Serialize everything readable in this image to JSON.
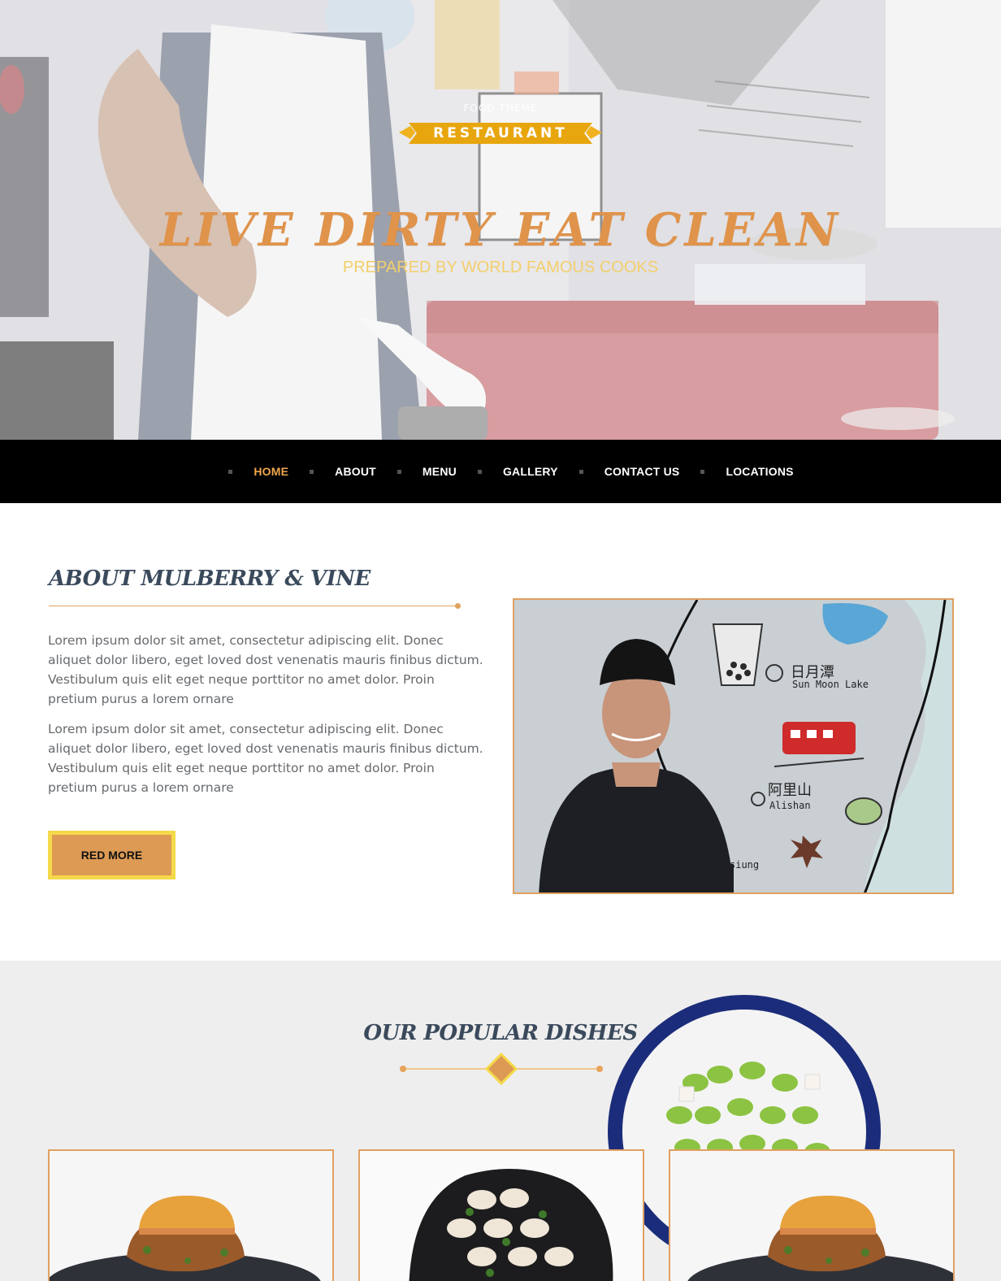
{
  "hero": {
    "kicker": "FOOD THEME",
    "ribbon_label": "RESTAURANT",
    "title": "LIVE DIRTY EAT CLEAN",
    "subtitle": "PREPARED BY WORLD FAMOUS COOKS"
  },
  "nav": {
    "items": [
      {
        "label": "HOME",
        "active": true
      },
      {
        "label": "ABOUT",
        "active": false
      },
      {
        "label": "MENU",
        "active": false
      },
      {
        "label": "GALLERY",
        "active": false
      },
      {
        "label": "CONTACT US",
        "active": false
      },
      {
        "label": "LOCATIONS",
        "active": false
      }
    ]
  },
  "about": {
    "title": "ABOUT MULBERRY & VINE",
    "paragraphs": [
      "Lorem ipsum dolor sit amet, consectetur adipiscing elit. Donec aliquet dolor libero, eget loved dost venenatis mauris finibus dictum. Vestibulum quis elit eget neque porttitor no amet dolor. Proin pretium purus a lorem ornare",
      "Lorem ipsum dolor sit amet, consectetur adipiscing elit. Donec aliquet dolor libero, eget loved dost venenatis mauris finibus dictum. Vestibulum quis elit eget neque porttitor no amet dolor. Proin pretium purus a lorem ornare"
    ],
    "button_label": "RED MORE",
    "photo_map_labels": {
      "lake_cn": "日月潭",
      "lake_en": "Sun Moon Lake",
      "mountain_cn": "阿里山",
      "mountain_en": "Alishan",
      "partial_en": "siung"
    }
  },
  "popular": {
    "title": "OUR POPULAR DISHES"
  },
  "colors": {
    "accent": "#e0934a",
    "nav_bg": "#000000",
    "nav_active": "#f0a64c",
    "heading": "#3a4a5c",
    "button_outer": "#f5d94a",
    "button_inner": "#dc9a54"
  }
}
